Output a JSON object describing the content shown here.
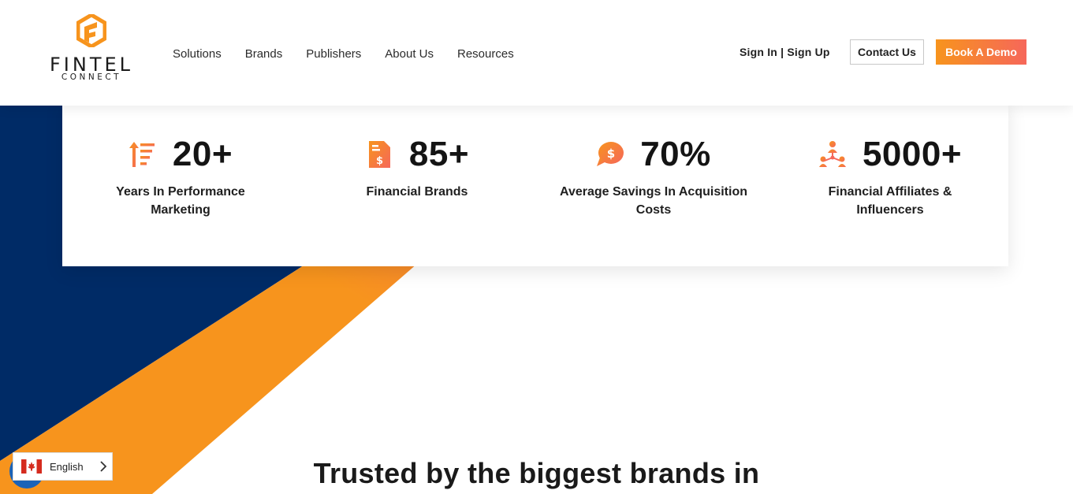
{
  "header": {
    "logo": {
      "word": "FINTEL",
      "sub": "CONNECT"
    },
    "nav": [
      {
        "label": "Solutions"
      },
      {
        "label": "Brands"
      },
      {
        "label": "Publishers"
      },
      {
        "label": "About Us"
      },
      {
        "label": "Resources"
      }
    ],
    "sign_in": "Sign In | Sign Up",
    "contact_button": "Contact Us",
    "demo_button": "Book A Demo"
  },
  "stats": [
    {
      "icon": "sort-ascending-icon",
      "value": "20+",
      "label": "Years In Performance Marketing"
    },
    {
      "icon": "dollar-document-icon",
      "value": "85+",
      "label": "Financial Brands"
    },
    {
      "icon": "dollar-speech-bubble-icon",
      "value": "70%",
      "label": "Average Savings In Acquisition Costs"
    },
    {
      "icon": "network-people-icon",
      "value": "5000+",
      "label": "Financial Affiliates & Influencers"
    }
  ],
  "heading": "Trusted by the biggest brands in",
  "language": {
    "label": "English",
    "flag": "canada-flag-icon"
  },
  "colors": {
    "navy": "#002b66",
    "orange": "#f7941d",
    "coral": "#f6675a",
    "accent_icon": "#f66c3f"
  }
}
